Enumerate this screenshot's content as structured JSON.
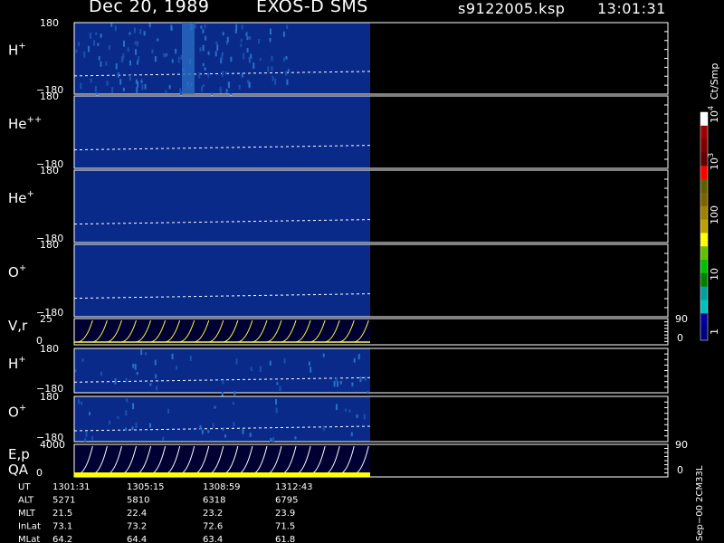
{
  "header": {
    "date": "Dec 20, 1989",
    "instrument": "EXOS-D SMS",
    "file": "s9122005.ksp",
    "time": "13:01:31"
  },
  "chart_data": {
    "type": "heatmap",
    "panels": [
      {
        "name": "H+",
        "label_base": "H",
        "label_sup": "+",
        "ytop": "180",
        "ybottom": "−180"
      },
      {
        "name": "He++",
        "label_base": "He",
        "label_sup": "++",
        "ytop": "180",
        "ybottom": "−180"
      },
      {
        "name": "He+",
        "label_base": "He",
        "label_sup": "+",
        "ytop": "180",
        "ybottom": "−180"
      },
      {
        "name": "O+",
        "label_base": "O",
        "label_sup": "+",
        "ytop": "180",
        "ybottom": "−180"
      },
      {
        "name": "V,r",
        "label_base": "V,r",
        "label_sup": "",
        "ytop": "25",
        "ybottom": "0",
        "right_top": "90",
        "right_bottom": "0"
      },
      {
        "name": "H+ (2)",
        "label_base": "H",
        "label_sup": "+",
        "ytop": "180",
        "ybottom": "−180"
      },
      {
        "name": "O+ (2)",
        "label_base": "O",
        "label_sup": "+",
        "ytop": "180",
        "ybottom": "−180"
      },
      {
        "name": "E,p QA",
        "label_base": "E,p",
        "label_line2": "QA",
        "label_sup": "",
        "ytop": "4000",
        "ybottom": "0",
        "right_top": "90",
        "right_bottom": "0"
      }
    ],
    "colorbar": {
      "unit": "Ct/Smp",
      "ticks": [
        "10",
        "10",
        "100",
        "10",
        "1"
      ],
      "tick_exponents": [
        "4",
        "3",
        "",
        "",
        ""
      ],
      "colors": [
        "#ffffff",
        "#a00000",
        "#800000",
        "#600000",
        "#ff0000",
        "#606000",
        "#806000",
        "#a08000",
        "#c0a000",
        "#ffff00",
        "#60c000",
        "#00c000",
        "#008000",
        "#00a0a0",
        "#00c0c0",
        "#0000a0",
        "#000080"
      ]
    },
    "footer": {
      "rows": [
        {
          "label": "UT",
          "values": [
            "1301:31",
            "1305:15",
            "1308:59",
            "1312:43"
          ]
        },
        {
          "label": "ALT",
          "values": [
            "5271",
            "5810",
            "6318",
            "6795"
          ]
        },
        {
          "label": "MLT",
          "values": [
            "21.5",
            "22.4",
            "23.2",
            "23.9"
          ]
        },
        {
          "label": "InLat",
          "values": [
            "73.1",
            "73.2",
            "72.6",
            "71.5"
          ]
        },
        {
          "label": "MLat",
          "values": [
            "64.2",
            "64.4",
            "63.4",
            "61.8"
          ]
        }
      ]
    },
    "side_text": "Sep−00  2CM33L"
  }
}
